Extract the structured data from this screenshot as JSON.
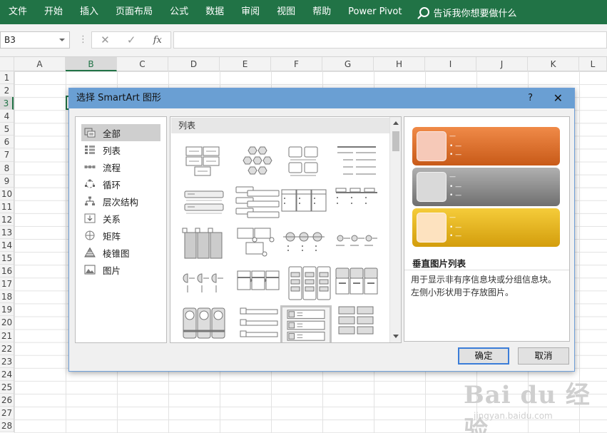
{
  "ribbon": {
    "tabs": [
      "文件",
      "开始",
      "插入",
      "页面布局",
      "公式",
      "数据",
      "审阅",
      "视图",
      "帮助",
      "Power Pivot"
    ],
    "tell_me": "告诉我你想要做什么",
    "bg_color": "#217346"
  },
  "formula_bar": {
    "name_box": "B3",
    "fx": "fx",
    "value": ""
  },
  "sheet": {
    "columns": [
      "A",
      "B",
      "C",
      "D",
      "E",
      "F",
      "G",
      "H",
      "I",
      "J",
      "K",
      "L"
    ],
    "rows": [
      "1",
      "2",
      "3",
      "4",
      "5",
      "6",
      "7",
      "8",
      "9",
      "10",
      "11",
      "12",
      "13",
      "14",
      "15",
      "16",
      "17",
      "18",
      "19",
      "20",
      "21",
      "22",
      "23",
      "24",
      "25",
      "26",
      "27",
      "28"
    ],
    "selected_cell": "B3"
  },
  "dialog": {
    "title": "选择 SmartArt 图形",
    "help": "?",
    "close": "✕",
    "categories": [
      {
        "label": "全部",
        "icon": "all-icon",
        "selected": true
      },
      {
        "label": "列表",
        "icon": "list-icon"
      },
      {
        "label": "流程",
        "icon": "process-icon"
      },
      {
        "label": "循环",
        "icon": "cycle-icon"
      },
      {
        "label": "层次结构",
        "icon": "hierarchy-icon"
      },
      {
        "label": "关系",
        "icon": "relationship-icon"
      },
      {
        "label": "矩阵",
        "icon": "matrix-icon"
      },
      {
        "label": "棱锥图",
        "icon": "pyramid-icon"
      },
      {
        "label": "图片",
        "icon": "picture-icon"
      }
    ],
    "gallery_header": "列表",
    "selected_layout_index": 18,
    "preview": {
      "title": "垂直图片列表",
      "description_line1": "用于显示非有序信息块或分组信息块。",
      "description_line2": "左侧小形状用于存放图片。",
      "bullet": "—",
      "colors": [
        "#e0702c",
        "#8d8d8d",
        "#e8b418"
      ]
    },
    "ok": "确定",
    "cancel": "取消"
  },
  "watermark": {
    "logo": "Bai du 经验",
    "url": "jingyan.baidu.com"
  }
}
